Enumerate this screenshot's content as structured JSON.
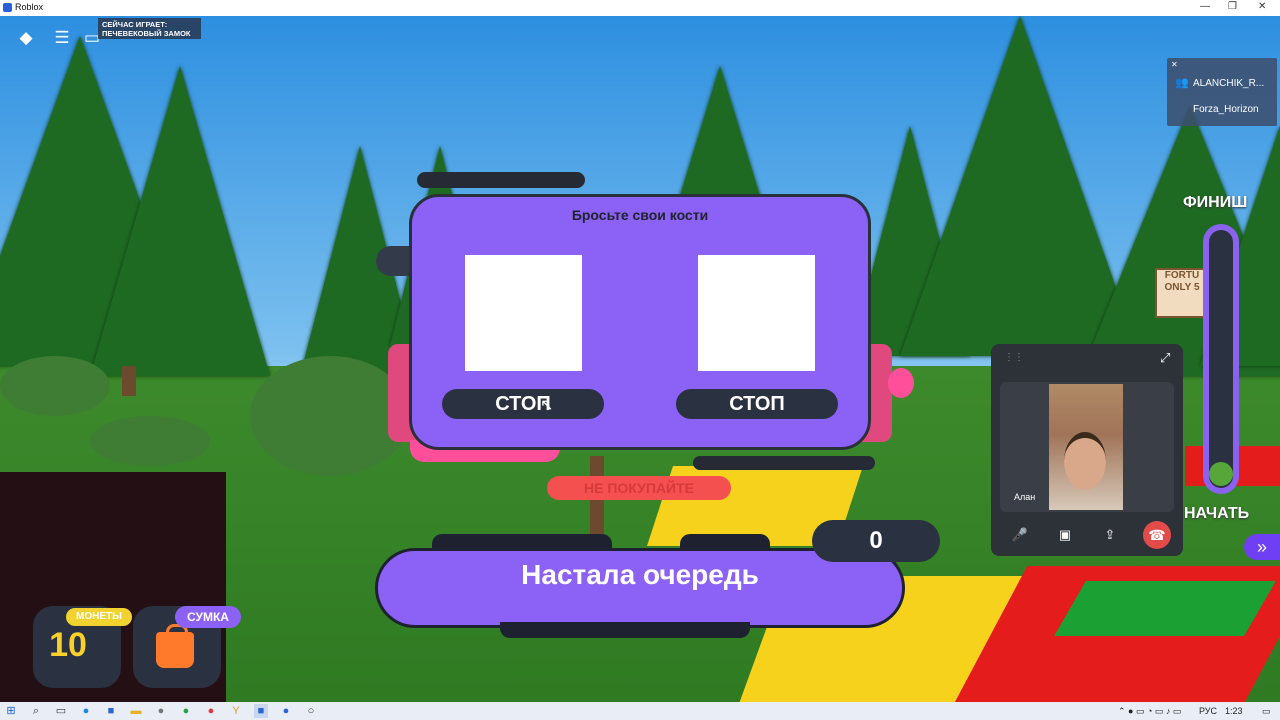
{
  "window": {
    "title": "Roblox",
    "controls": [
      "—",
      "❐",
      "✕"
    ]
  },
  "topbar": {
    "playing_label": "СЕЙЧАС ИГРАЕТ:",
    "playing_track": "ПЕЧЕВЕКОВЫЙ ЗАМОК",
    "icons": [
      "roblox-logo-icon",
      "menu-icon",
      "chat-icon"
    ]
  },
  "users_panel": {
    "user1": "ALANCHIK_R...",
    "user2": "Forza_Horizon"
  },
  "progress": {
    "finish_label": "ФИНИШ",
    "start_label": "НАЧАТЬ",
    "level": 0
  },
  "sign": {
    "line1": "FORTU",
    "line2": "ONLY 5"
  },
  "dice_panel": {
    "title": "Бросьте свои кости",
    "stop_left": "СТОП",
    "stop_right": "СТОП"
  },
  "no_buy": "НЕ ПОКУПАЙТЕ",
  "counter": "0",
  "turn_banner": "Настала очередь",
  "coins": {
    "label": "МОНЕТЫ",
    "value": "10"
  },
  "bag": {
    "label": "СУМКА"
  },
  "video": {
    "name": "Алан"
  },
  "taskbar": {
    "lang": "РУС",
    "time": "1:23"
  },
  "colors": {
    "purple": "#8c61f5",
    "dark": "#2a3140",
    "yellow": "#f7d12a",
    "pink": "#ff4f9a"
  }
}
